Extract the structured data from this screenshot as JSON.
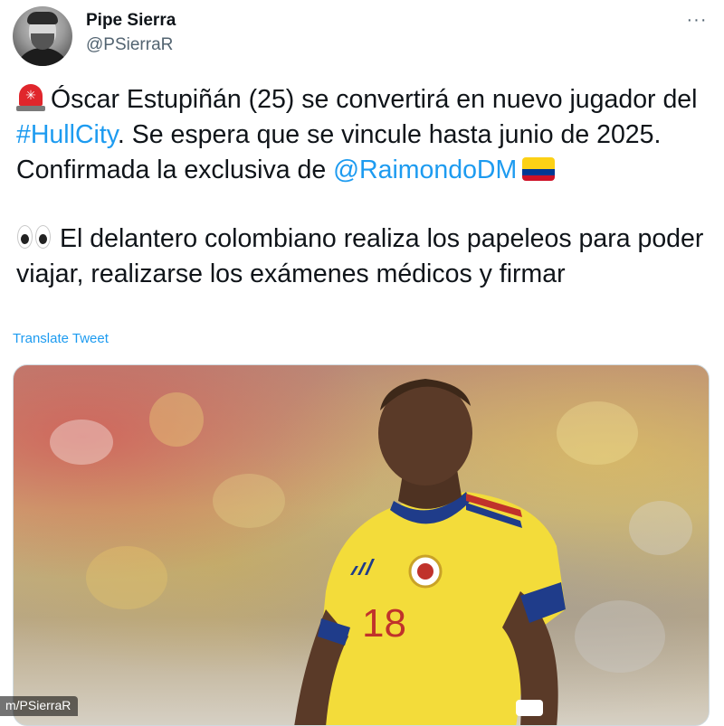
{
  "author": {
    "name": "Pipe Sierra",
    "handle": "@PSierraR"
  },
  "menu": {
    "more_label": "···"
  },
  "tweet": {
    "paragraph1": {
      "emoji": "rotating-light",
      "text_before_hashtag": "Óscar Estupiñán (25) se convertirá en nuevo jugador del ",
      "hashtag": "#HullCity",
      "text_after_hashtag": ". Se espera que se vincule hasta junio de 2025. Confirmada la exclusiva de ",
      "mention": "@RaimondoDM",
      "trailing_emoji": "flag-colombia"
    },
    "paragraph2": {
      "emoji": "eyes",
      "text": "El delantero colombiano realiza los papeleos para poder viajar, realizarse los exámenes médicos y firmar"
    }
  },
  "translate_link": "Translate Tweet",
  "media": {
    "description_icon": "photo-football-player",
    "jersey_number": "18",
    "watermark": "m/PSierraR"
  },
  "colors": {
    "link": "#1d9bf0",
    "text": "#0f1419",
    "secondary": "#536471",
    "jersey": "#f3dc3a",
    "flag_yellow": "#fcd116",
    "flag_blue": "#003893",
    "flag_red": "#ce1126"
  }
}
